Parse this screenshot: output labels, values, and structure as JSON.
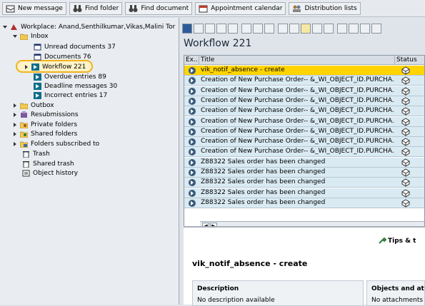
{
  "toolbar": {
    "new_message": "New message",
    "find_folder": "Find folder",
    "find_document": "Find document",
    "appointment_calendar": "Appointment calendar",
    "distribution_lists": "Distribution lists"
  },
  "tree": {
    "workplace": "Workplace: Anand,Senthilkumar,Vikas,Malini Tor",
    "inbox": "Inbox",
    "unread": "Unread documents  37",
    "documents": "Documents  76",
    "workflow": "Workflow 221",
    "overdue": "Overdue entries  89",
    "deadline": "Deadline messages  30",
    "incorrect": "Incorrect entries  17",
    "outbox": "Outbox",
    "resubmissions": "Resubmissions",
    "private_folders": "Private folders",
    "shared_folders": "Shared folders",
    "folders_subscribed": "Folders subscribed to",
    "trash": "Trash",
    "shared_trash": "Shared trash",
    "object_history": "Object history"
  },
  "main": {
    "title": "Workflow 221",
    "columns": {
      "ex": "Ex..",
      "title": "Title",
      "status": "Status"
    },
    "rows": [
      "vik_notif_absence - create",
      "Creation of New Purchase Order-- &_WI_OBJECT_ID.PURCHA...",
      "Creation of New Purchase Order-- &_WI_OBJECT_ID.PURCHA...",
      "Creation of New Purchase Order-- &_WI_OBJECT_ID.PURCHA...",
      "Creation of New Purchase Order-- &_WI_OBJECT_ID.PURCHA...",
      "Creation of New Purchase Order-- &_WI_OBJECT_ID.PURCHA...",
      "Creation of New Purchase Order-- &_WI_OBJECT_ID.PURCHA...",
      "Creation of New Purchase Order-- &_WI_OBJECT_ID.PURCHA...",
      "Creation of New Purchase Order-- &_WI_OBJECT_ID.PURCHA...",
      "Z88322 Sales order has been changed",
      "Z88322 Sales order has been changed",
      "Z88322 Sales order has been changed",
      "Z88322 Sales order has been changed",
      "Z88322 Sales order has been changed"
    ],
    "colors": {
      "selected_row": "#ffd400",
      "row": "#d9eaf3"
    }
  },
  "preview": {
    "tips": "Tips & t",
    "title": "vik_notif_absence - create",
    "description_label": "Description",
    "description_value": "No description available",
    "objects_label": "Objects and atta",
    "objects_value": "No attachments c"
  }
}
